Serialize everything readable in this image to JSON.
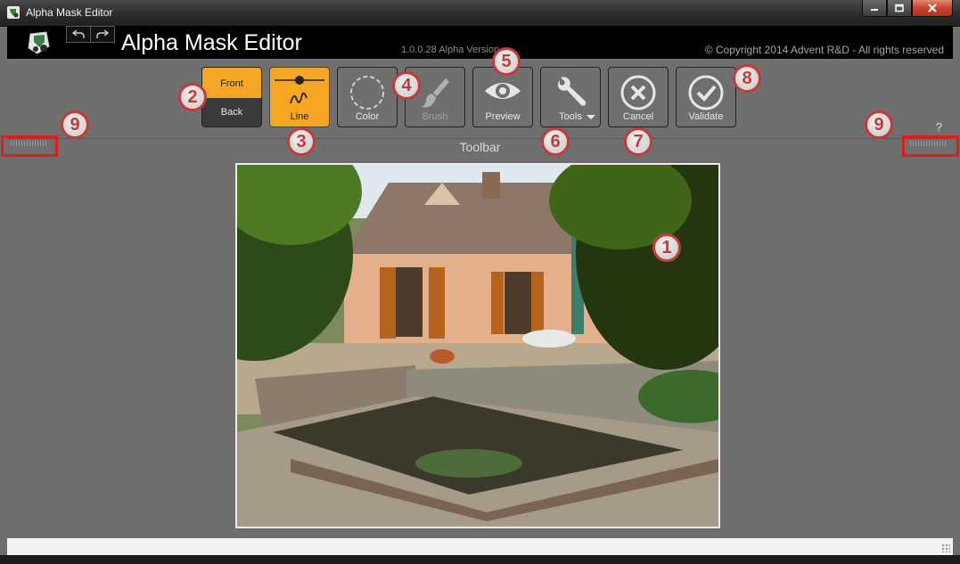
{
  "window": {
    "title": "Alpha Mask Editor",
    "controls": {
      "minimize": "minimize-icon",
      "maximize": "maximize-icon",
      "close": "close-icon"
    }
  },
  "header": {
    "title": "Alpha Mask Editor",
    "version": "1.0.0.28 Alpha Version",
    "copyright": "© Copyright 2014 Advent R&D - All rights reserved",
    "undo_icon": "undo-icon",
    "redo_icon": "redo-icon"
  },
  "toolbar": {
    "caption": "Toolbar",
    "help": "?",
    "front_label": "Front",
    "back_label": "Back",
    "line_label": "Line",
    "color_label": "Color",
    "brush_label": "Brush",
    "preview_label": "Preview",
    "tools_label": "Tools",
    "cancel_label": "Cancel",
    "validate_label": "Validate",
    "active_color": "#f5a623"
  },
  "callouts": [
    "1",
    "2",
    "3",
    "4",
    "5",
    "6",
    "7",
    "8",
    "9",
    "9"
  ],
  "colors": {
    "callout_border": "#c63a3a",
    "highlight": "#e21b1b",
    "panel": "#6f6f6f"
  }
}
